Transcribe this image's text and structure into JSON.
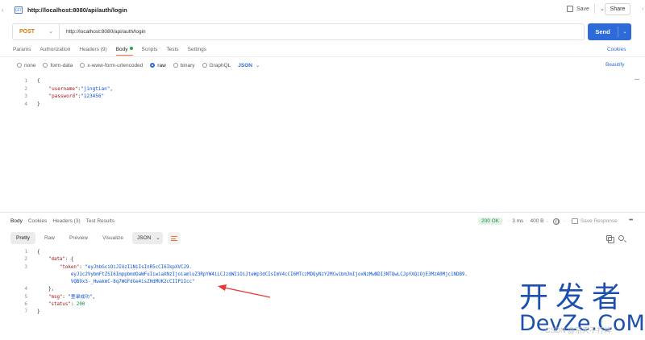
{
  "header": {
    "request_icon_text": "GET",
    "title": "http://localhost:8080/api/auth/login",
    "save_label": "Save",
    "share_label": "Share"
  },
  "request": {
    "method": "POST",
    "url": "http://localhost:8080/api/auth/login",
    "send_label": "Send"
  },
  "req_tabs": {
    "params": "Params",
    "authorization": "Authorization",
    "headers": "Headers (9)",
    "body": "Body",
    "scripts": "Scripts",
    "tests": "Tests",
    "settings": "Settings",
    "cookies": "Cookies"
  },
  "body_types": {
    "none": "none",
    "form_data": "form-data",
    "urlencoded": "x-www-form-urlencoded",
    "raw": "raw",
    "binary": "binary",
    "graphql": "GraphQL",
    "format": "JSON",
    "beautify": "Beautify"
  },
  "request_body": {
    "line_numbers": [
      "1",
      "2",
      "3",
      "4"
    ],
    "open_brace": "{",
    "username_key": "\"username\"",
    "username_value": "\"jingtian\"",
    "password_key": "\"password\"",
    "password_value": "\"123456\"",
    "close_brace": "}"
  },
  "resp_tabs": {
    "body": "Body",
    "cookies": "Cookies",
    "headers": "Headers (3)",
    "test_results": "Test Results"
  },
  "resp_status": {
    "status": "200 OK",
    "time": "3 ms",
    "size": "400 B",
    "save_response": "Save Response"
  },
  "view_modes": {
    "pretty": "Pretty",
    "raw": "Raw",
    "preview": "Preview",
    "visualize": "Visualize",
    "format": "JSON"
  },
  "response_body": {
    "line_numbers": [
      "1",
      "2",
      "3",
      "4",
      "5",
      "6",
      "7"
    ],
    "open_brace": "{",
    "data_key": "\"data\"",
    "data_open": ": {",
    "token_key": "\"token\"",
    "token_line1": "\"eyJhbGciOiJIUzI1NiIsInR5cCI6IkpXVCJ9.",
    "token_line2": "eyJ1c2VybmFtZSI6ImppbmdOaWFuIiwiaXNzIjoiamluZ3RpYW4iLCJzdWIiOiJteWp3dCIsImV4cCI6MTczMDQyNzY2MCwibmJmIjoxNzMwNDI3NTQwLCJpYXQiOjE3MzA0Mjc1NDB9.",
    "token_line3": "VQB9x3-_HwakmC-8q7WGFdGe4isZHdMUK2cCIIP1Icc\"",
    "data_close": "},",
    "msg_key": "\"msg\"",
    "msg_value": "\"登录成功\"",
    "status_key": "\"status\"",
    "status_value": "200",
    "close_brace": "}"
  },
  "watermark": {
    "line1": "开发者",
    "line2": "DevZe.CoM",
    "sub": "CSDN @京天不打烊"
  },
  "colors": {
    "send_button": "#2f6bd8",
    "method": "#d97706",
    "status_ok": "#1c8a43",
    "annotation_arrow": "#e53935",
    "watermark": "#1b4fb0"
  }
}
